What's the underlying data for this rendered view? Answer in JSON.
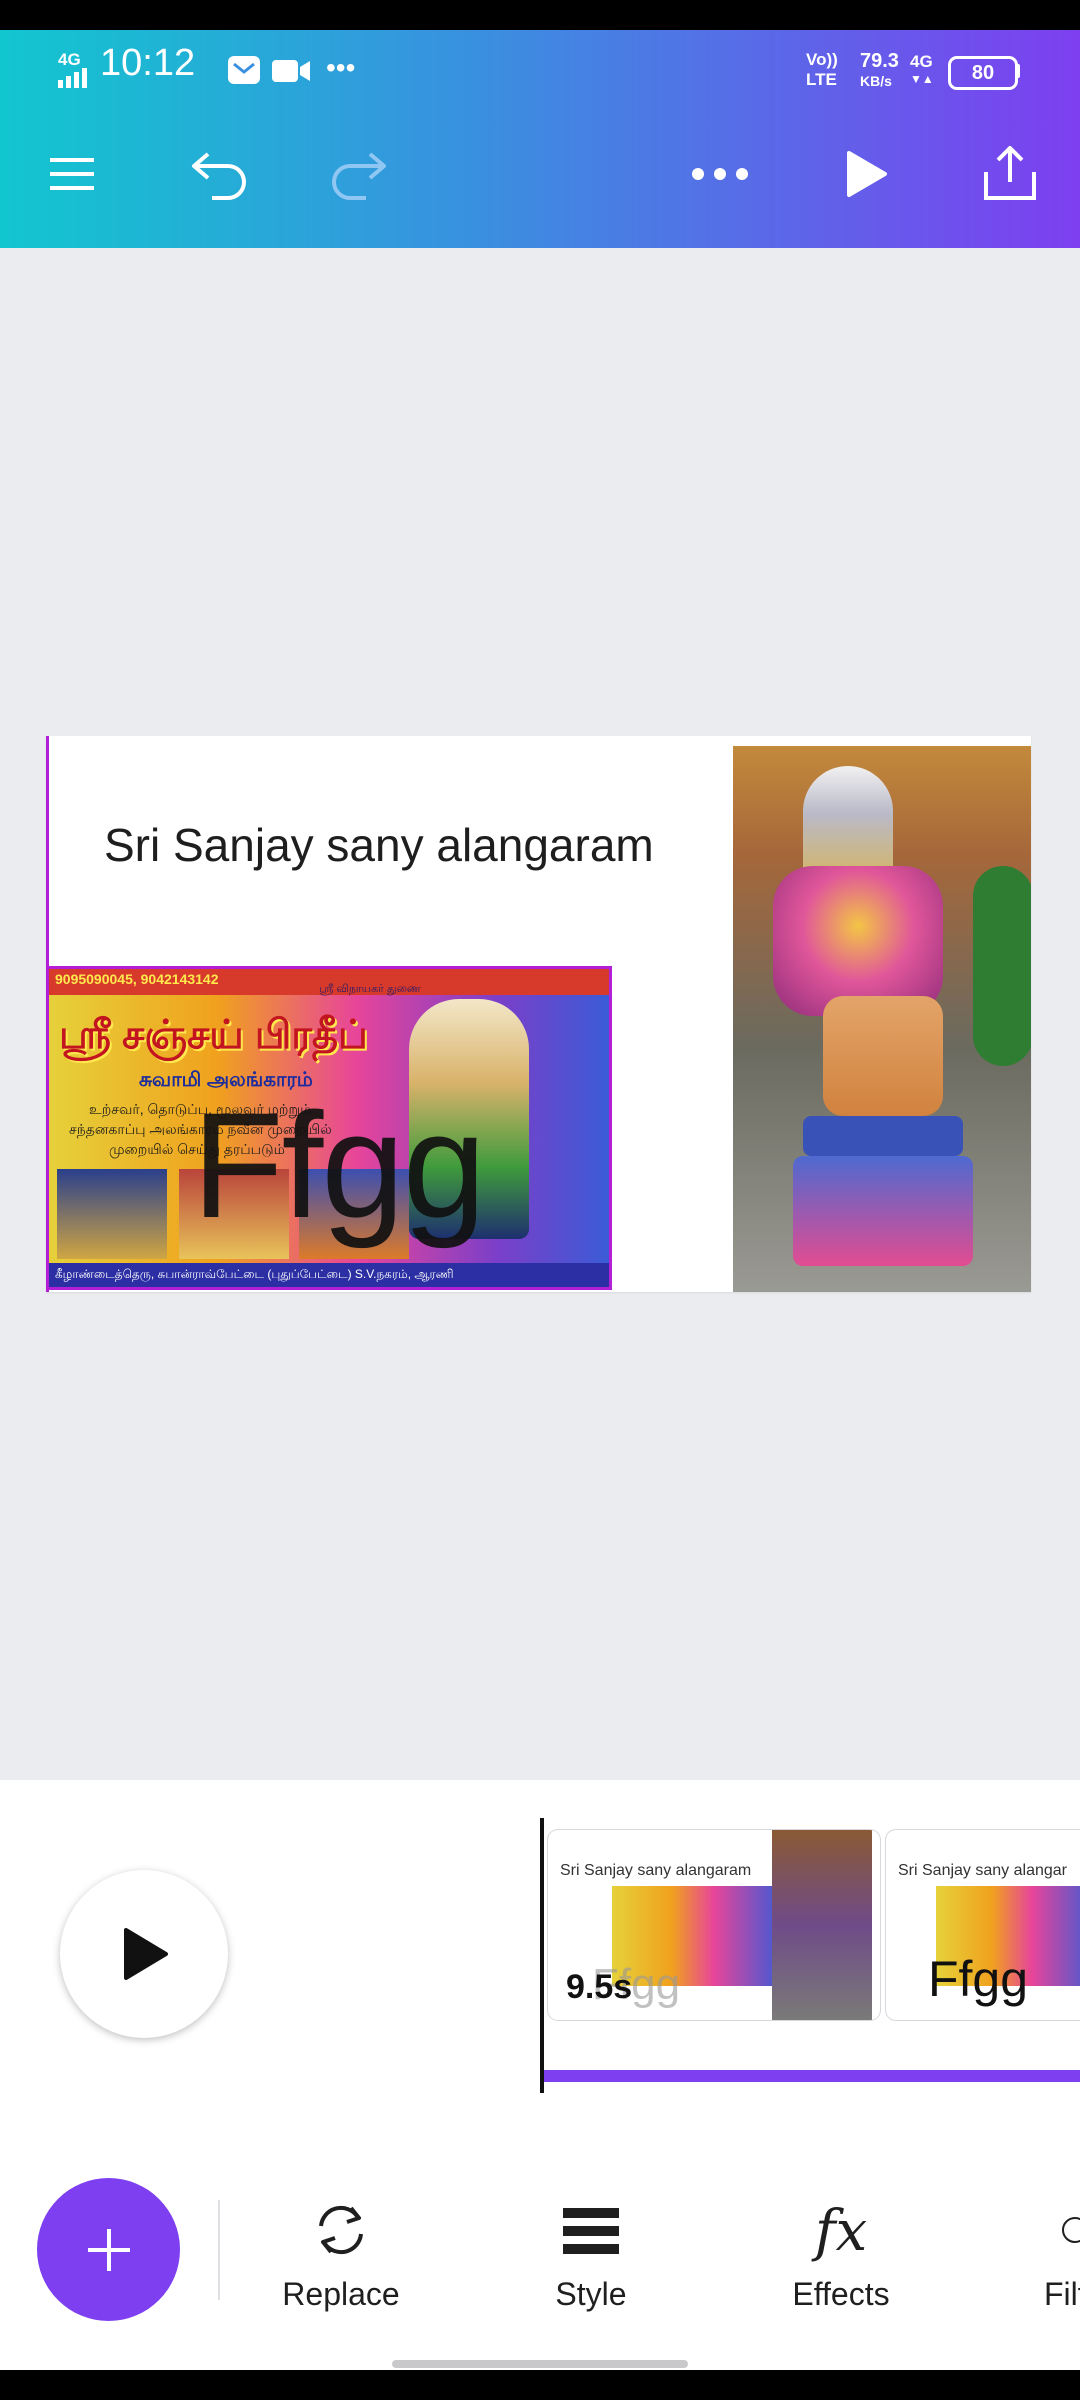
{
  "status_bar": {
    "network_left": "4G",
    "time": "10:12",
    "more": "•••",
    "volte": "Vo))",
    "lte": "LTE",
    "speed_value": "79.3",
    "speed_unit": "KB/s",
    "network_right": "4G",
    "battery": "80"
  },
  "toolbar_top": {
    "icons": [
      "menu-icon",
      "undo-icon",
      "redo-icon",
      "more-icon",
      "play-icon",
      "share-icon"
    ]
  },
  "design": {
    "title": "Sri Sanjay sany alangaram",
    "overlay_text": "Ffgg",
    "banner": {
      "contact": "9095090045, 9042143142",
      "tagline": "ஸ்ரீ விநாயகர் துணை",
      "heading": "ஸ்ரீ சஞ்சய் பிரதீப்",
      "subheading": "சுவாமி அலங்காரம்",
      "line1": "உற்சவர், தொடுப்பு, மூலவர் மற்றும்",
      "line2": "சந்தனகாப்பு அலங்காரம் நவீன முறையில்",
      "line3": "முறையில் செய்து தரப்படும்",
      "footer": "கீழாண்டைத்தெரு, சுபான்ராவ்பேட்டை (புதுப்பேட்டை) S.V.நகரம், ஆரணி"
    }
  },
  "timeline": {
    "clip1": {
      "title": "Sri Sanjay sany alangaram",
      "duration": "9.5s"
    },
    "clip2": {
      "title": "Sri Sanjay sany alangar",
      "text": "Ffgg"
    },
    "accent_color": "#7d3ff0"
  },
  "bottom_toolbar": {
    "replace": "Replace",
    "style": "Style",
    "effects": "Effects",
    "filter": "Filt",
    "effects_icon_text": "fx"
  }
}
